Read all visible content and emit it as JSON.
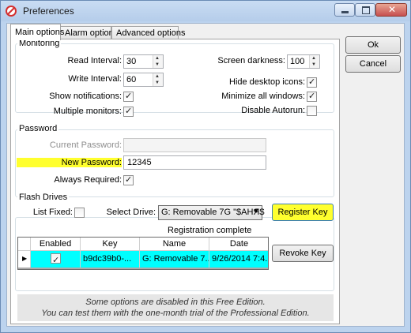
{
  "window": {
    "title": "Preferences"
  },
  "tabs": [
    {
      "label": "Main options",
      "active": true
    },
    {
      "label": "Alarm options",
      "active": false
    },
    {
      "label": "Advanced options",
      "active": false
    }
  ],
  "monitoring": {
    "group_label": "Monitoring",
    "read_interval": {
      "label": "Read Interval:",
      "value": "30"
    },
    "write_interval": {
      "label": "Write Interval:",
      "value": "60"
    },
    "show_notifications": {
      "label": "Show notifications:",
      "checked": true
    },
    "multiple_monitors": {
      "label": "Multiple monitors:",
      "checked": true
    },
    "screen_darkness": {
      "label": "Screen darkness:",
      "value": "100"
    },
    "hide_desktop_icons": {
      "label": "Hide desktop icons:",
      "checked": true
    },
    "minimize_all_windows": {
      "label": "Minimize all windows:",
      "checked": true
    },
    "disable_autorun": {
      "label": "Disable Autorun:",
      "checked": false
    }
  },
  "password": {
    "group_label": "Password",
    "current_password": {
      "label": "Current Password:",
      "value": ""
    },
    "new_password": {
      "label": "New Password:",
      "value": "12345"
    },
    "always_required": {
      "label": "Always Required:",
      "checked": true
    }
  },
  "flash_drives": {
    "group_label": "Flash Drives",
    "list_fixed": {
      "label": "List Fixed:",
      "checked": false
    },
    "select_drive": {
      "label": "Select Drive:",
      "value": "G: Removable 7G \"$AHЯ$"
    },
    "register_key_label": "Register Key",
    "registration_status": "Registration complete",
    "revoke_key_label": "Revoke Key",
    "grid": {
      "columns": [
        "Enabled",
        "Key",
        "Name",
        "Date"
      ],
      "rows": [
        {
          "enabled": true,
          "key": "b9dc39b0-...",
          "name": "G: Removable 7...",
          "date": "9/26/2014 7:4..."
        }
      ]
    }
  },
  "notice": {
    "line1": "Some options are disabled in this Free Edition.",
    "line2": "You can test them with the one-month trial of the Professional Edition."
  },
  "buttons": {
    "ok_label": "Ok",
    "cancel_label": "Cancel"
  },
  "colors": {
    "highlight_yellow": "#ffff2e",
    "row_selected": "#00ffff",
    "app_icon_red": "#d32f2f"
  }
}
